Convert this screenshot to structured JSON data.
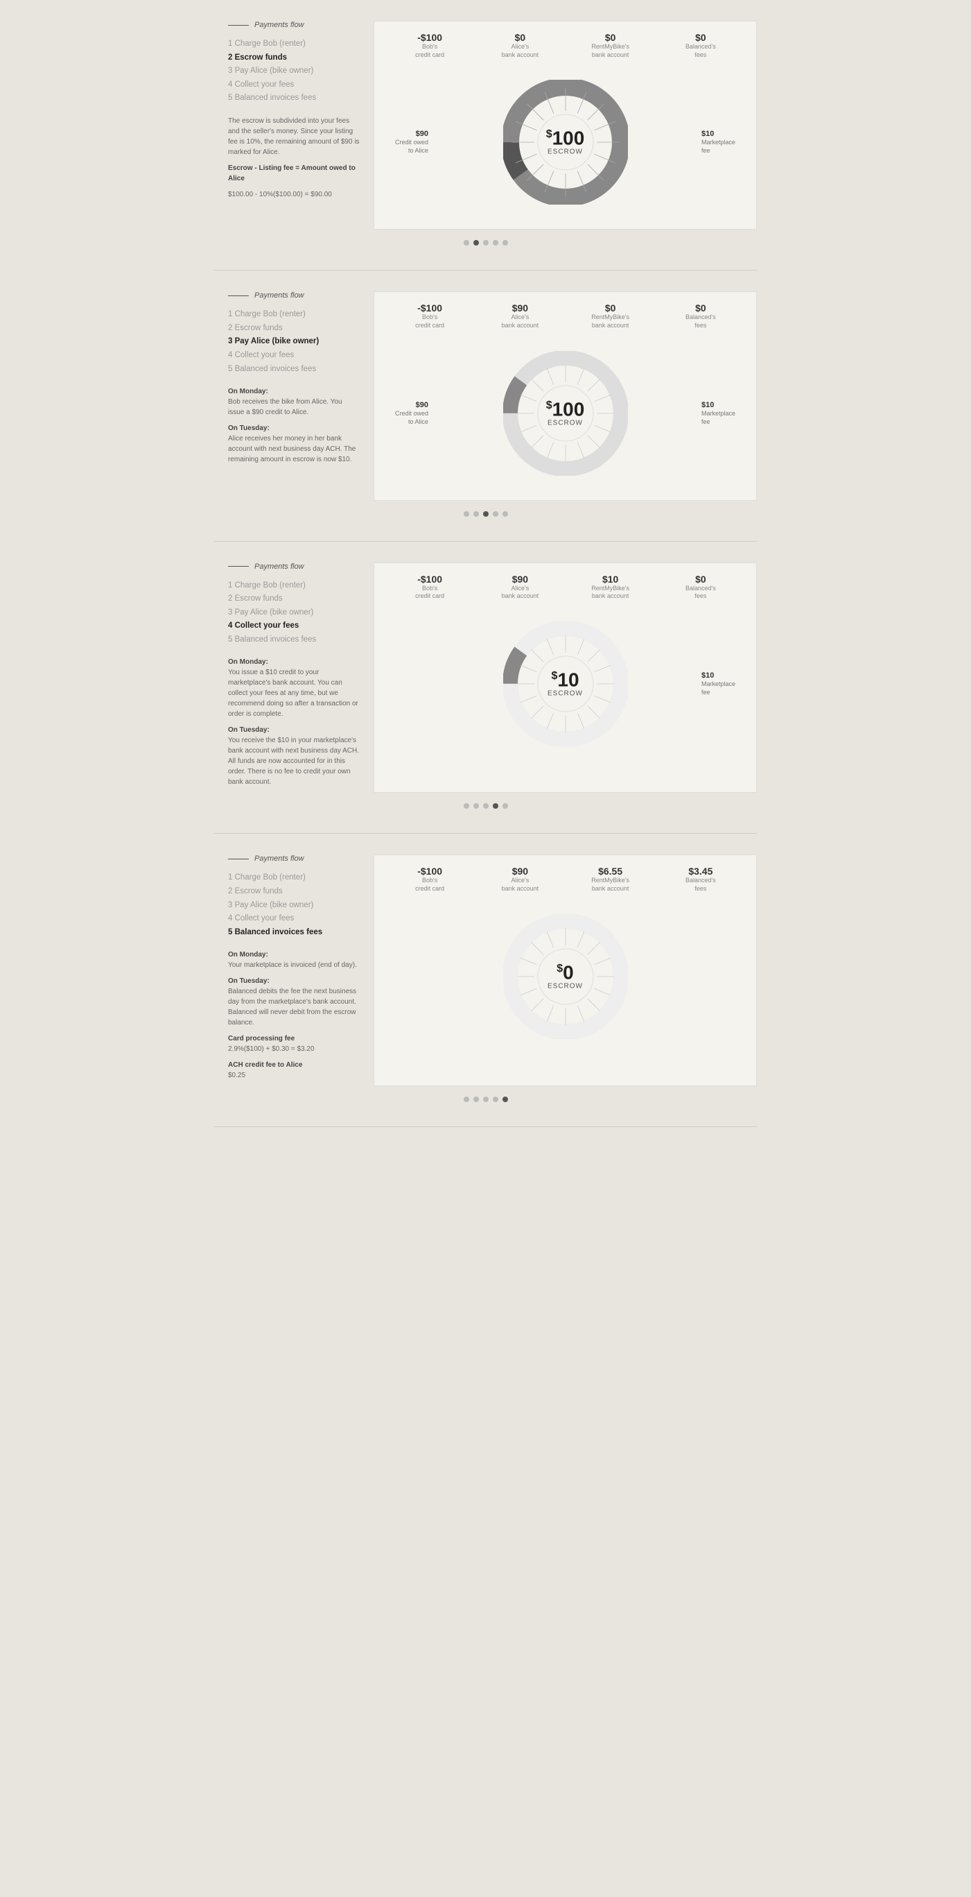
{
  "panels": [
    {
      "id": "panel1",
      "header": "Payments flow",
      "steps": [
        {
          "num": "1",
          "label": "Charge Bob (renter)",
          "active": false
        },
        {
          "num": "2",
          "label": "Escrow funds",
          "active": true
        },
        {
          "num": "3",
          "label": "Pay Alice (bike owner)",
          "active": false
        },
        {
          "num": "4",
          "label": "Collect your fees",
          "active": false
        },
        {
          "num": "5",
          "label": "Balanced invoices fees",
          "active": false
        }
      ],
      "description": "The escrow is subdivided into your fees and the seller's money. Since your listing fee is 10%, the remaining amount of $90 is marked for Alice.",
      "formula_label": "Escrow - Listing fee = Amount owed to Alice",
      "formula": "$100.00 - 10%($100.00) = $90.00",
      "amounts": [
        {
          "value": "-$100",
          "label": "Bob's\ncredit card"
        },
        {
          "value": "$0",
          "label": "Alice's\nbank account"
        },
        {
          "value": "$0",
          "label": "RentMyBike's\nbank account"
        },
        {
          "value": "$0",
          "label": "Balanced's\nfees"
        }
      ],
      "donut": {
        "amount": "100",
        "label": "ESCROW",
        "segments": [
          {
            "pct": 90,
            "color": "#888"
          },
          {
            "pct": 10,
            "color": "#555"
          }
        ],
        "annotations": [
          {
            "text": "$90",
            "side": "left",
            "subtext": "Credit owed\nto Alice"
          },
          {
            "text": "$10",
            "side": "right",
            "subtext": "Marketplace\nfee"
          }
        ]
      },
      "dots": [
        false,
        true,
        false,
        false,
        false
      ]
    },
    {
      "id": "panel2",
      "header": "Payments flow",
      "steps": [
        {
          "num": "1",
          "label": "Charge Bob (renter)",
          "active": false
        },
        {
          "num": "2",
          "label": "Escrow funds",
          "active": false
        },
        {
          "num": "3",
          "label": "Pay Alice (bike owner)",
          "active": true
        },
        {
          "num": "4",
          "label": "Collect your fees",
          "active": false
        },
        {
          "num": "5",
          "label": "Balanced invoices fees",
          "active": false
        }
      ],
      "description_parts": [
        {
          "label": "On Monday:",
          "text": "Bob receives the bike from Alice. You issue a $90 credit to Alice."
        },
        {
          "label": "On Tuesday:",
          "text": "Alice receives her money in her bank account with next business day ACH. The remaining amount in escrow is now $10."
        }
      ],
      "amounts": [
        {
          "value": "-$100",
          "label": "Bob's\ncredit card"
        },
        {
          "value": "$90",
          "label": "Alice's\nbank account"
        },
        {
          "value": "$0",
          "label": "RentMyBike's\nbank account"
        },
        {
          "value": "$0",
          "label": "Balanced's\nfees"
        }
      ],
      "donut": {
        "amount": "100",
        "label": "ESCROW",
        "segments": [
          {
            "pct": 10,
            "color": "#888"
          },
          {
            "pct": 90,
            "color": "#ddd"
          }
        ],
        "annotations": [
          {
            "text": "$90",
            "side": "left",
            "subtext": "Credit owed\nto Alice"
          },
          {
            "text": "$10",
            "side": "right",
            "subtext": "Marketplace\nfee"
          }
        ]
      },
      "dots": [
        false,
        false,
        true,
        false,
        false
      ]
    },
    {
      "id": "panel3",
      "header": "Payments flow",
      "steps": [
        {
          "num": "1",
          "label": "Charge Bob (renter)",
          "active": false
        },
        {
          "num": "2",
          "label": "Escrow funds",
          "active": false
        },
        {
          "num": "3",
          "label": "Pay Alice (bike owner)",
          "active": false
        },
        {
          "num": "4",
          "label": "Collect your fees",
          "active": true
        },
        {
          "num": "5",
          "label": "Balanced invoices fees",
          "active": false
        }
      ],
      "description_parts": [
        {
          "label": "On Monday:",
          "text": "You issue a $10 credit to your marketplace's bank account. You can collect your fees at any time, but we recommend doing so after a transaction or order is complete."
        },
        {
          "label": "On Tuesday:",
          "text": "You receive the $10 in your marketplace's bank account with next business day ACH. All funds are now accounted for in this order. There is no fee to credit your own bank account."
        }
      ],
      "amounts": [
        {
          "value": "-$100",
          "label": "Bob's\ncredit card"
        },
        {
          "value": "$90",
          "label": "Alice's\nbank account"
        },
        {
          "value": "$10",
          "label": "RentMyBike's\nbank account"
        },
        {
          "value": "$0",
          "label": "Balanced's\nfees"
        }
      ],
      "donut": {
        "amount": "10",
        "label": "ESCROW",
        "segments": [
          {
            "pct": 10,
            "color": "#888"
          },
          {
            "pct": 90,
            "color": "#eee"
          }
        ],
        "annotations": [
          {
            "text": "$10",
            "side": "right",
            "subtext": "Marketplace\nfee"
          }
        ]
      },
      "dots": [
        false,
        false,
        false,
        true,
        false
      ]
    },
    {
      "id": "panel4",
      "header": "Payments flow",
      "steps": [
        {
          "num": "1",
          "label": "Charge Bob (renter)",
          "active": false
        },
        {
          "num": "2",
          "label": "Escrow funds",
          "active": false
        },
        {
          "num": "3",
          "label": "Pay Alice (bike owner)",
          "active": false
        },
        {
          "num": "4",
          "label": "Collect your fees",
          "active": false
        },
        {
          "num": "5",
          "label": "Balanced invoices fees",
          "active": true
        }
      ],
      "description_parts": [
        {
          "label": "On Monday:",
          "text": "Your marketplace is invoiced (end of day)."
        },
        {
          "label": "On Tuesday:",
          "text": "Balanced debits the fee the next business day from the marketplace's bank account. Balanced will never debit from the escrow balance."
        }
      ],
      "extra_info": [
        {
          "label": "Card processing fee",
          "text": "2.9%($100) + $0.30 = $3.20"
        },
        {
          "label": "ACH credit fee to Alice",
          "text": "$0.25"
        }
      ],
      "amounts": [
        {
          "value": "-$100",
          "label": "Bob's\ncredit card"
        },
        {
          "value": "$90",
          "label": "Alice's\nbank account"
        },
        {
          "value": "$6.55",
          "label": "RentMyBike's\nbank account"
        },
        {
          "value": "$3.45",
          "label": "Balanced's\nfees"
        }
      ],
      "donut": {
        "amount": "0",
        "label": "ESCROW",
        "segments": [
          {
            "pct": 0,
            "color": "#888"
          },
          {
            "pct": 100,
            "color": "#eee"
          }
        ],
        "annotations": []
      },
      "dots": [
        false,
        false,
        false,
        false,
        true
      ]
    }
  ]
}
